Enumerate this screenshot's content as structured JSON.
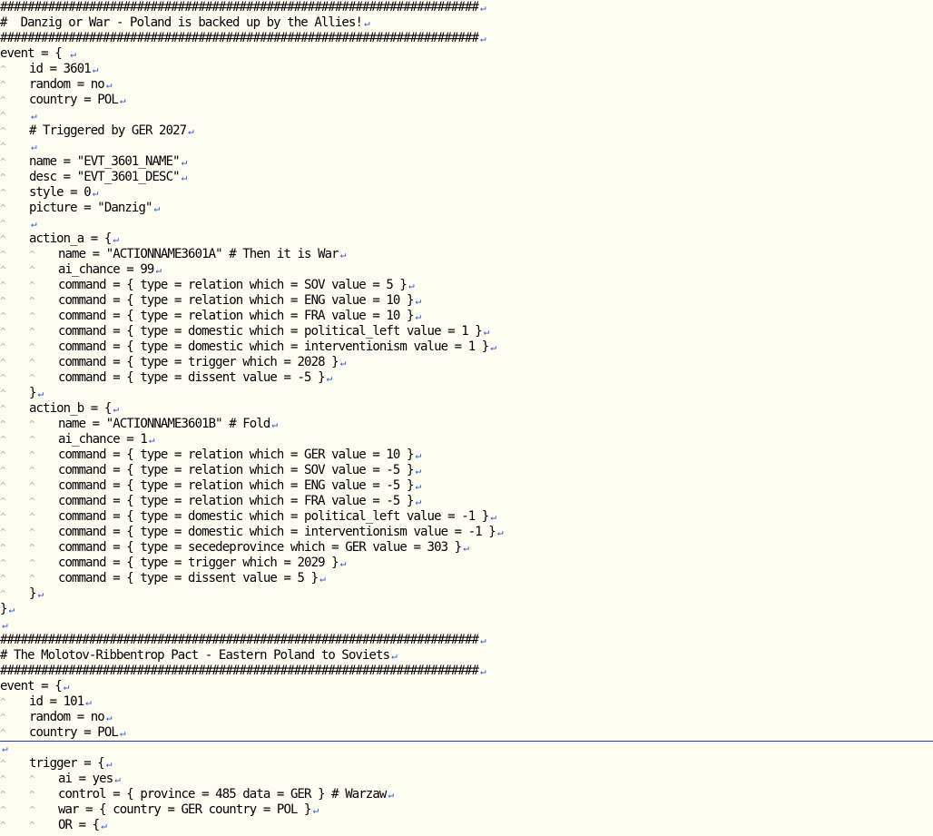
{
  "editor": {
    "colors": {
      "background": "#fffcf2",
      "text": "#000000",
      "eol_mark": "#2b55d0",
      "tab_mark": "#b0b0b0",
      "current_line": "#2536b8"
    },
    "symbols": {
      "tab_mark": "^",
      "eol_mark": "↵"
    },
    "lines": [
      {
        "i": 0,
        "t": "######################################################################"
      },
      {
        "i": 0,
        "t": "#  Danzig or War - Poland is backed up by the Allies!"
      },
      {
        "i": 0,
        "t": "######################################################################"
      },
      {
        "i": 0,
        "t": "event = { "
      },
      {
        "i": 1,
        "t": "id = 3601"
      },
      {
        "i": 1,
        "t": "random = no"
      },
      {
        "i": 1,
        "t": "country = POL"
      },
      {
        "i": 1,
        "t": ""
      },
      {
        "i": 1,
        "t": "# Triggered by GER 2027"
      },
      {
        "i": 1,
        "t": ""
      },
      {
        "i": 1,
        "t": "name = \"EVT_3601_NAME\""
      },
      {
        "i": 1,
        "t": "desc = \"EVT_3601_DESC\""
      },
      {
        "i": 1,
        "t": "style = 0"
      },
      {
        "i": 1,
        "t": "picture = \"Danzig\""
      },
      {
        "i": 1,
        "t": ""
      },
      {
        "i": 1,
        "t": "action_a = {"
      },
      {
        "i": 2,
        "t": "name = \"ACTIONNAME3601A\" # Then it is War"
      },
      {
        "i": 2,
        "t": "ai_chance = 99"
      },
      {
        "i": 2,
        "t": "command = { type = relation which = SOV value = 5 }"
      },
      {
        "i": 2,
        "t": "command = { type = relation which = ENG value = 10 }"
      },
      {
        "i": 2,
        "t": "command = { type = relation which = FRA value = 10 }"
      },
      {
        "i": 2,
        "t": "command = { type = domestic which = political_left value = 1 }"
      },
      {
        "i": 2,
        "t": "command = { type = domestic which = interventionism value = 1 }"
      },
      {
        "i": 2,
        "t": "command = { type = trigger which = 2028 }"
      },
      {
        "i": 2,
        "t": "command = { type = dissent value = -5 }"
      },
      {
        "i": 1,
        "t": "}"
      },
      {
        "i": 1,
        "t": "action_b = {"
      },
      {
        "i": 2,
        "t": "name = \"ACTIONNAME3601B\" # Fold"
      },
      {
        "i": 2,
        "t": "ai_chance = 1"
      },
      {
        "i": 2,
        "t": "command = { type = relation which = GER value = 10 }"
      },
      {
        "i": 2,
        "t": "command = { type = relation which = SOV value = -5 }"
      },
      {
        "i": 2,
        "t": "command = { type = relation which = ENG value = -5 }"
      },
      {
        "i": 2,
        "t": "command = { type = relation which = FRA value = -5 }"
      },
      {
        "i": 2,
        "t": "command = { type = domestic which = political_left value = -1 }"
      },
      {
        "i": 2,
        "t": "command = { type = domestic which = interventionism value = -1 }"
      },
      {
        "i": 2,
        "t": "command = { type = secedeprovince which = GER value = 303 }"
      },
      {
        "i": 2,
        "t": "command = { type = trigger which = 2029 }"
      },
      {
        "i": 2,
        "t": "command = { type = dissent value = 5 }"
      },
      {
        "i": 1,
        "t": "}"
      },
      {
        "i": 0,
        "t": "}"
      },
      {
        "i": 0,
        "t": ""
      },
      {
        "i": 0,
        "t": "######################################################################"
      },
      {
        "i": 0,
        "t": "# The Molotov-Ribbentrop Pact - Eastern Poland to Soviets"
      },
      {
        "i": 0,
        "t": "######################################################################"
      },
      {
        "i": 0,
        "t": "event = {"
      },
      {
        "i": 1,
        "t": "id = 101"
      },
      {
        "i": 1,
        "t": "random = no"
      },
      {
        "i": 1,
        "t": "country = POL"
      },
      {
        "i": 0,
        "t": ""
      },
      {
        "i": 1,
        "t": "trigger = {"
      },
      {
        "i": 2,
        "t": "ai = yes"
      },
      {
        "i": 2,
        "t": "control = { province = 485 data = GER } # Warzaw"
      },
      {
        "i": 2,
        "t": "war = { country = GER country = POL }"
      },
      {
        "i": 2,
        "t": "OR = {"
      }
    ]
  }
}
